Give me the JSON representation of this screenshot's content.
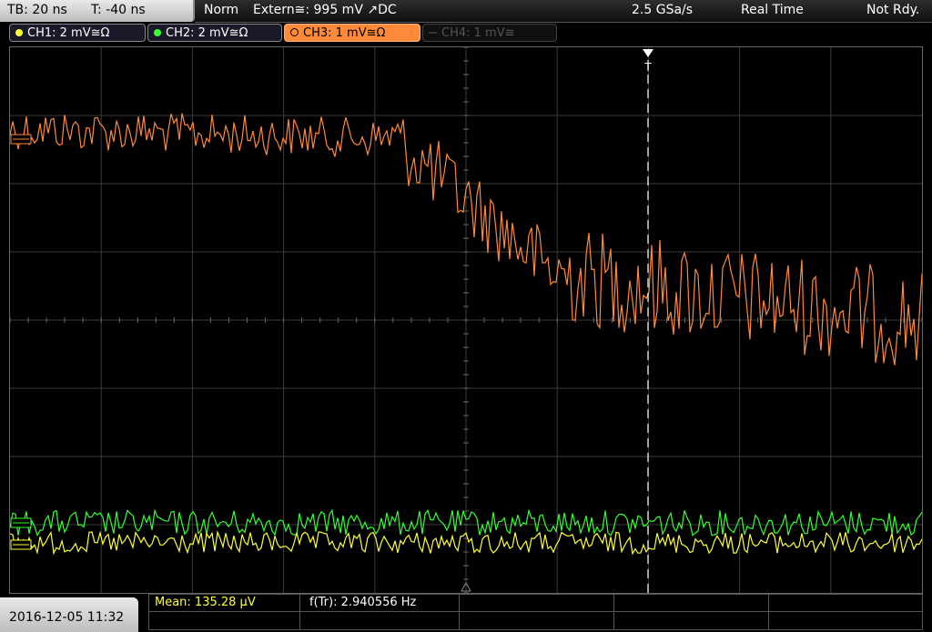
{
  "status_bar": {
    "timebase": "TB: 20 ns",
    "trigger_time": "T: -40 ns",
    "mode": "Norm",
    "trigger_source": "Extern≅: 995 mV ↗DC",
    "sample_rate": "2.5 GSa/s",
    "acquisition": "Real Time",
    "state": "Not Rdy."
  },
  "channels": [
    {
      "label": "CH1: 2 mV≅Ω",
      "color": "#ffff33",
      "active": true
    },
    {
      "label": "CH2: 2 mV≅Ω",
      "color": "#33ff33",
      "active": true
    },
    {
      "label": "CH3: 1 mV≅Ω",
      "color": "#ff8a3a",
      "active": true,
      "selected": true
    },
    {
      "label": "CH4: 1 mV≅",
      "color": "#555555",
      "active": false
    }
  ],
  "trigger_marker": "T",
  "bottom_bar": {
    "datetime": "2016-12-05 11:32",
    "mean_label": "Mean: 135.28 µV",
    "freq_label": "f(Tr): 2.940556 Hz"
  },
  "colors": {
    "ch1": "#ffff33",
    "ch2": "#33ff33",
    "ch3": "#ff8a3a",
    "grid": "#3c3c3c",
    "mean_text": "#ffff33"
  }
}
